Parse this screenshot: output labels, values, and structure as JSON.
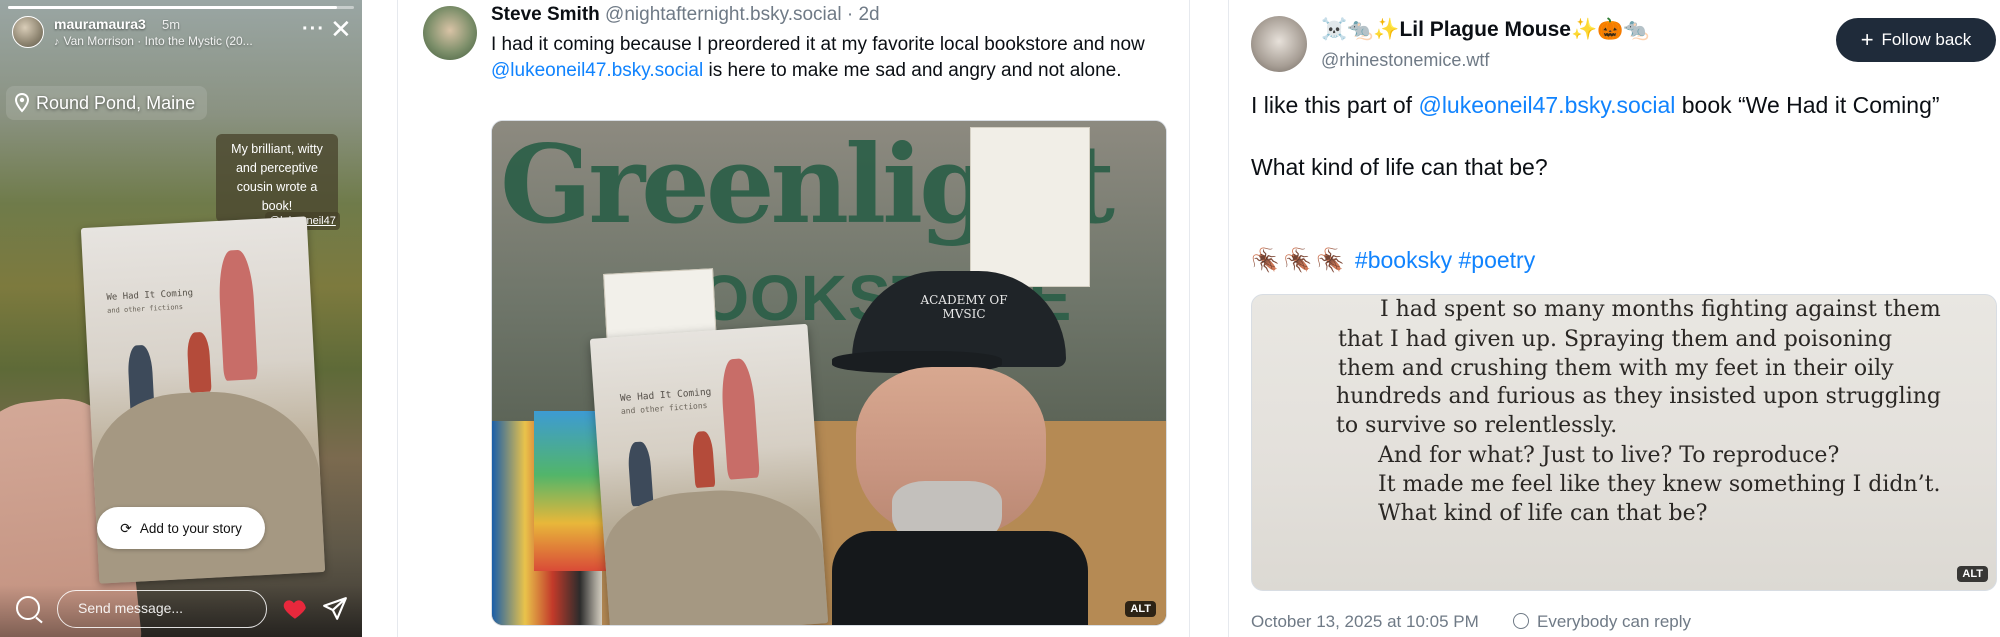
{
  "story": {
    "progress": 0.95,
    "username": "mauramaura3",
    "time": "5m",
    "music": "Van Morrison · Into the Mystic (20...",
    "location": "Round Pond, Maine",
    "caption": "My brilliant, witty and perceptive cousin wrote a book!",
    "mention": "@lukeoneil47",
    "book_title": "We Had It Coming",
    "book_subtitle": "and other fictions",
    "add_button": "Add to your story",
    "message_placeholder": "Send message...",
    "icons": [
      "music-icon",
      "more-icon",
      "close-icon",
      "location-pin-icon",
      "refresh-icon",
      "camera-icon",
      "heart-icon",
      "send-icon"
    ],
    "colors": {
      "heart": "#e8283c"
    }
  },
  "post1": {
    "name": "Steve Smith",
    "handle": "@nightafternight.bsky.social",
    "time": "2d",
    "text_before": "I had it coming because I preordered it at my favorite local bookstore and now ",
    "mention": "@lukeoneil47.bsky.social",
    "text_after": " is here to make me sad and angry and not alone.",
    "image": {
      "sign_top": "Greenlight",
      "sign_bottom": "BOOKSTORE",
      "book_title": "We Had It Coming",
      "book_subtitle": "and other fictions",
      "cap_text": "ACADEMY OF MVSIC"
    },
    "alt_badge": "ALT",
    "colors": {
      "mention": "#1083fe",
      "sign": "#2c5f48"
    }
  },
  "post2": {
    "name": "☠️🐀✨Lil Plague Mouse✨🎃🐀",
    "handle": "@rhinestonemice.wtf",
    "follow_label": "Follow back",
    "text_before": "I like this part of ",
    "mention": "@lukeoneil47.bsky.social",
    "text_after": " book “We Had it Coming”",
    "question": "What kind of life can that be?",
    "bugs": "🪳🪳🪳",
    "tags": [
      "#booksky",
      "#poetry"
    ],
    "page_lines": [
      "I had spent so many months fighting against them",
      "that I had given up. Spraying them and poisoning",
      "them and crushing them with my feet in their oily",
      "hundreds and furious as they insisted upon struggling",
      "to survive so relentlessly.",
      "And for what? Just to live? To reproduce?",
      "It made me feel like they knew something I didn’t.",
      "What kind of life can that be?"
    ],
    "alt_badge": "ALT",
    "date": "October 13, 2025 at 10:05 PM",
    "reply_setting": "Everybody can reply",
    "colors": {
      "follow_bg": "#1f2b3a",
      "tag": "#1083fe"
    }
  }
}
